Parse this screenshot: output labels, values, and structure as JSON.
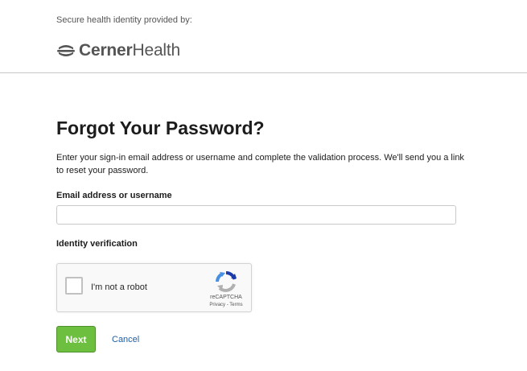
{
  "header": {
    "provided_by": "Secure health identity provided by:",
    "logo": {
      "icon": "cerner-logo-icon",
      "brand_bold": "Cerner",
      "brand_regular": "Health",
      "color": "#555555"
    }
  },
  "main": {
    "title": "Forgot Your Password?",
    "instructions": "Enter your sign-in email address or username and complete the validation process. We'll send you a link to reset your password.",
    "email_label": "Email address or username",
    "email_value": "",
    "email_placeholder": "",
    "identity_label": "Identity verification",
    "recaptcha": {
      "checkbox_label": "I'm not a robot",
      "brand": "reCAPTCHA",
      "privacy": "Privacy",
      "separator": " - ",
      "terms": "Terms",
      "icon": "recaptcha-icon"
    },
    "next_label": "Next",
    "cancel_label": "Cancel"
  },
  "colors": {
    "next_button": "#6cbf3f",
    "cancel_link": "#1e5fa8",
    "divider": "#c8c8c8"
  }
}
